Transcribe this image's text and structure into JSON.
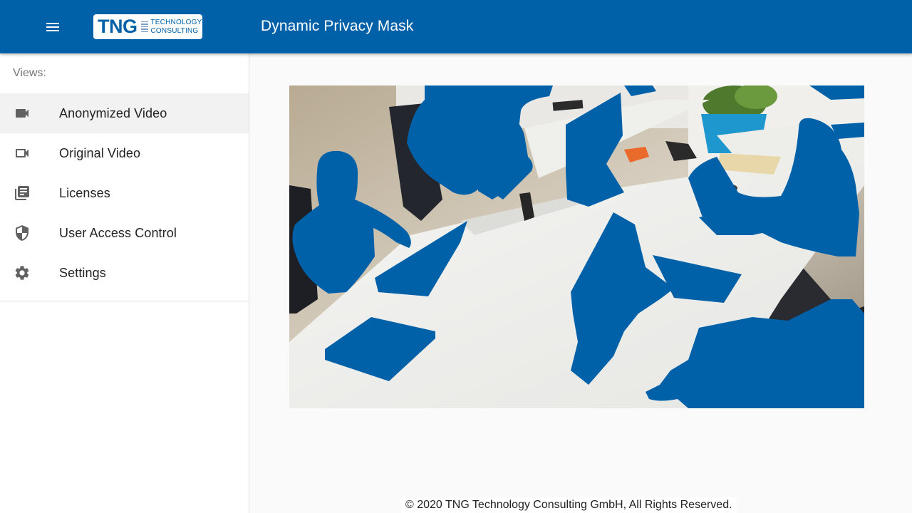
{
  "header": {
    "menu_icon": "menu-icon",
    "logo": {
      "brand": "TNG",
      "line1": "TECHNOLOGY",
      "line2": "CONSULTING"
    },
    "title": "Dynamic Privacy Mask"
  },
  "sidebar": {
    "section_label": "Views:",
    "items": [
      {
        "label": "Anonymized Video",
        "icon": "videocam-filled-icon",
        "active": true
      },
      {
        "label": "Original Video",
        "icon": "videocam-outline-icon",
        "active": false
      },
      {
        "label": "Licenses",
        "icon": "library-books-icon",
        "active": false
      },
      {
        "label": "User Access Control",
        "icon": "shield-icon",
        "active": false
      },
      {
        "label": "Settings",
        "icon": "gear-icon",
        "active": false
      }
    ]
  },
  "main": {
    "video": {
      "mask_color": "#0061a8"
    }
  },
  "footer": {
    "text": "© 2020 TNG Technology Consulting GmbH, All Rights Reserved."
  },
  "colors": {
    "primary": "#0061a8",
    "sidebar_active": "#f2f2f2",
    "icon": "#616161"
  }
}
